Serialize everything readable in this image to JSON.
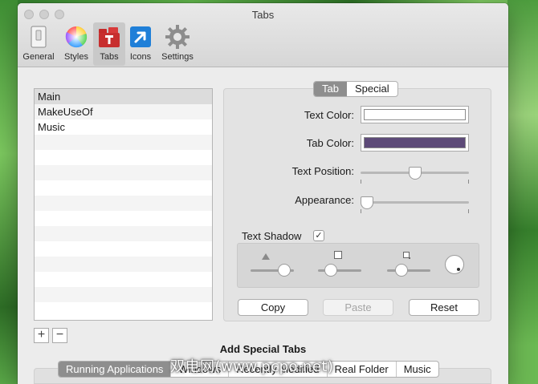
{
  "window": {
    "title": "Tabs"
  },
  "toolbar": {
    "items": [
      {
        "label": "General",
        "icon": "general-prefs-icon"
      },
      {
        "label": "Styles",
        "icon": "color-wheel-icon"
      },
      {
        "label": "Tabs",
        "icon": "tabs-icon",
        "selected": true
      },
      {
        "label": "Icons",
        "icon": "app-icon"
      },
      {
        "label": "Settings",
        "icon": "gear-icon"
      }
    ]
  },
  "list": {
    "items": [
      {
        "label": "Main",
        "selected": true
      },
      {
        "label": "MakeUseOf"
      },
      {
        "label": "Music"
      }
    ],
    "add_label": "+",
    "remove_label": "−"
  },
  "panel": {
    "segments": [
      {
        "label": "Tab",
        "selected": true
      },
      {
        "label": "Special"
      }
    ],
    "text_color_label": "Text Color:",
    "text_color": "#ffffff",
    "tab_color_label": "Tab Color:",
    "tab_color": "#5d4a78",
    "text_position_label": "Text Position:",
    "text_position_value": 0.5,
    "appearance_label": "Appearance:",
    "appearance_value": 0.0,
    "text_shadow_label": "Text Shadow",
    "text_shadow_checked": true,
    "checkmark": "✓",
    "shadow_controls": {
      "opacity": 0.9,
      "size": 0.2,
      "blur": 0.25
    },
    "buttons": {
      "copy": "Copy",
      "paste": "Paste",
      "reset": "Reset"
    }
  },
  "special_tabs": {
    "title": "Add Special Tabs",
    "segments": [
      {
        "label": "Running Applications",
        "selected": true
      },
      {
        "label": "Windows"
      },
      {
        "label": "Recently Modified"
      },
      {
        "label": "Real Folder"
      },
      {
        "label": "Music"
      }
    ]
  },
  "watermark": "双电网(www.pcpo.net)"
}
